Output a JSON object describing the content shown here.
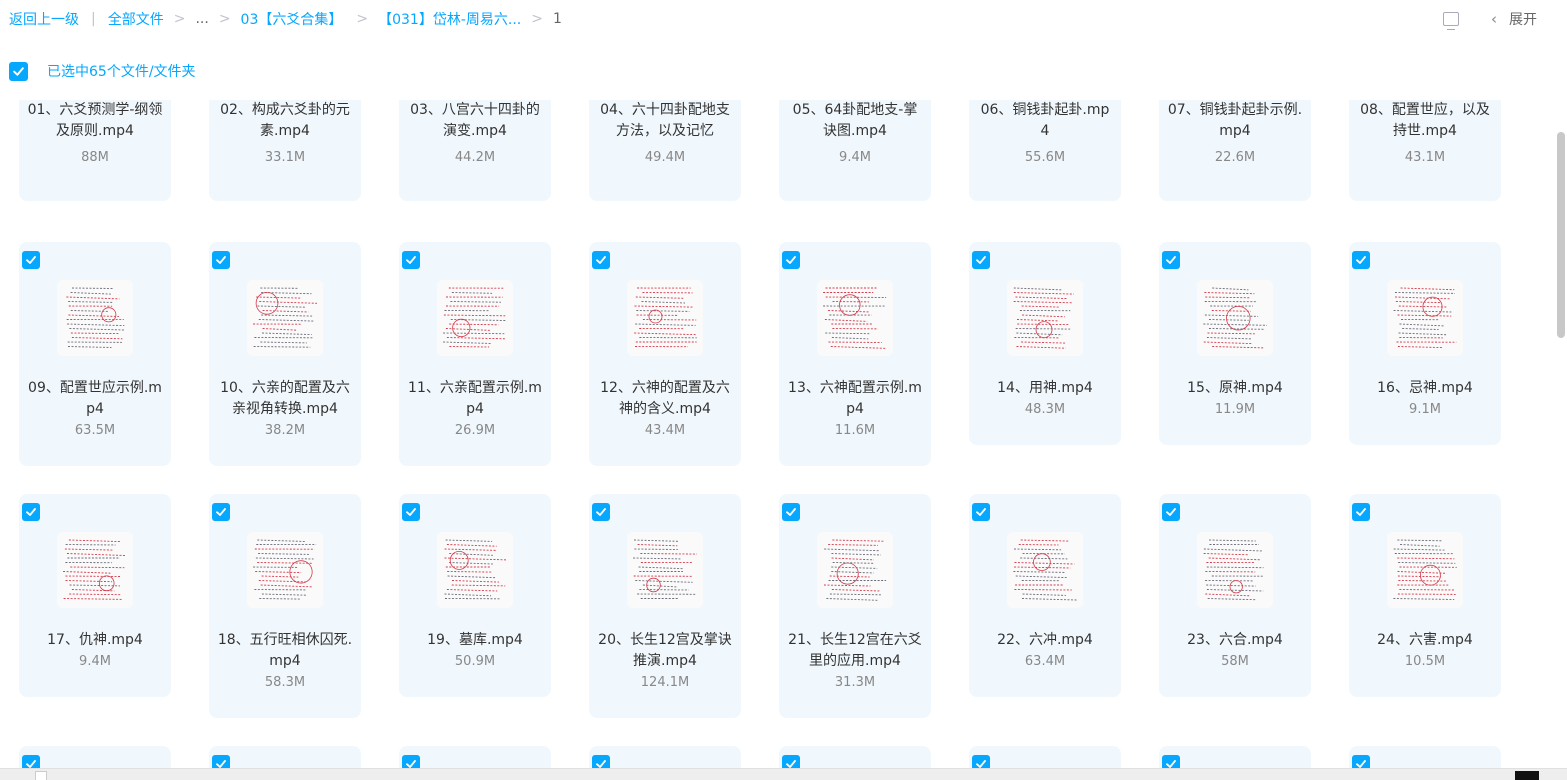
{
  "breadcrumb": {
    "back": "返回上一级",
    "all_files": "全部文件",
    "ellipsis": "...",
    "folder1": "03【六爻合集】",
    "folder2": "【031】岱林-周易六...",
    "current": "1"
  },
  "toolbar": {
    "expand_label": "展开"
  },
  "selection": {
    "text": "已选中65个文件/文件夹"
  },
  "files": [
    {
      "name": "01、六爻预测学-纲领及原则.mp4",
      "size": "88M"
    },
    {
      "name": "02、构成六爻卦的元素.mp4",
      "size": "33.1M"
    },
    {
      "name": "03、八宫六十四卦的演变.mp4",
      "size": "44.2M"
    },
    {
      "name": "04、六十四卦配地支方法，以及记忆",
      "size": "49.4M"
    },
    {
      "name": "05、64卦配地支-掌诀图.mp4",
      "size": "9.4M"
    },
    {
      "name": "06、铜钱卦起卦.mp4",
      "size": "55.6M"
    },
    {
      "name": "07、铜钱卦起卦示例.mp4",
      "size": "22.6M"
    },
    {
      "name": "08、配置世应，以及持世.mp4",
      "size": "43.1M"
    },
    {
      "name": "09、配置世应示例.mp4",
      "size": "63.5M"
    },
    {
      "name": "10、六亲的配置及六亲视角转换.mp4",
      "size": "38.2M"
    },
    {
      "name": "11、六亲配置示例.mp4",
      "size": "26.9M"
    },
    {
      "name": "12、六神的配置及六神的含义.mp4",
      "size": "43.4M"
    },
    {
      "name": "13、六神配置示例.mp4",
      "size": "11.6M"
    },
    {
      "name": "14、用神.mp4",
      "size": "48.3M"
    },
    {
      "name": "15、原神.mp4",
      "size": "11.9M"
    },
    {
      "name": "16、忌神.mp4",
      "size": "9.1M"
    },
    {
      "name": "17、仇神.mp4",
      "size": "9.4M"
    },
    {
      "name": "18、五行旺相休囚死.mp4",
      "size": "58.3M"
    },
    {
      "name": "19、墓库.mp4",
      "size": "50.9M"
    },
    {
      "name": "20、长生12宫及掌诀推演.mp4",
      "size": "124.1M"
    },
    {
      "name": "21、长生12宫在六爻里的应用.mp4",
      "size": "31.3M"
    },
    {
      "name": "22、六冲.mp4",
      "size": "63.4M"
    },
    {
      "name": "23、六合.mp4",
      "size": "58M"
    },
    {
      "name": "24、六害.mp4",
      "size": "10.5M"
    }
  ]
}
